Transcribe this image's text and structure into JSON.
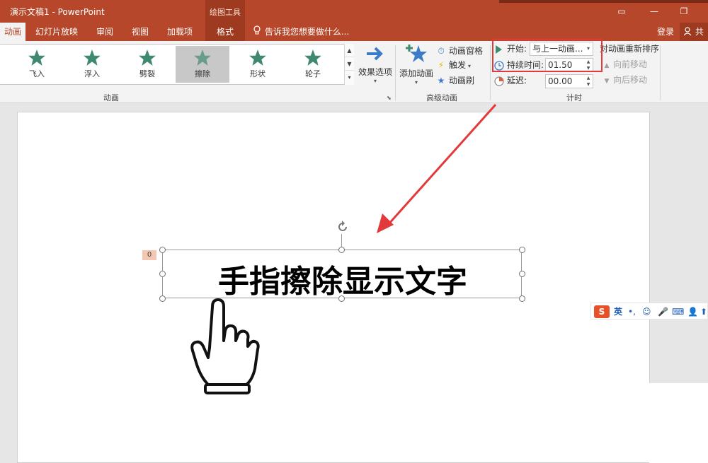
{
  "title": {
    "document": "演示文稿1 - PowerPoint",
    "context_group": "绘图工具"
  },
  "window_buttons": {
    "restore_ribbon": "▭",
    "minimize": "—",
    "maximize": "❐"
  },
  "tabs": {
    "animations": "动画",
    "slideshow": "幻灯片放映",
    "review": "审阅",
    "view": "视图",
    "addins": "加载项",
    "format": "格式",
    "tell_me": "告诉我您想要做什么...",
    "login": "登录",
    "share": "共享"
  },
  "gallery": [
    {
      "label": "飞入",
      "color": "#3f8a6e"
    },
    {
      "label": "浮入",
      "color": "#3f8a6e"
    },
    {
      "label": "劈裂",
      "color": "#3f8a6e"
    },
    {
      "label": "擦除",
      "color": "#3f8a6e"
    },
    {
      "label": "形状",
      "color": "#3f8a6e"
    },
    {
      "label": "轮子",
      "color": "#3f8a6e"
    }
  ],
  "ribbon": {
    "effect_options": "效果选项",
    "animation_group_label": "动画",
    "add_animation": "添加动画",
    "animation_pane": "动画窗格",
    "trigger": "触发",
    "animation_painter": "动画刷",
    "advanced_group_label": "高级动画",
    "start_label": "开始:",
    "start_value": "与上一动画...",
    "duration_label": "持续时间:",
    "duration_value": "01.50",
    "delay_label": "延迟:",
    "delay_value": "00.00",
    "reorder_label": "对动画重新排序",
    "move_earlier": "向前移动",
    "move_later": "向后移动",
    "timing_group_label": "计时"
  },
  "slide": {
    "anim_number": "0",
    "text": "手指擦除显示文字"
  },
  "ime": {
    "lang": "英"
  },
  "colors": {
    "accent": "#b7472a",
    "highlight": "#e23a3a",
    "star": "#3f8a6e"
  }
}
